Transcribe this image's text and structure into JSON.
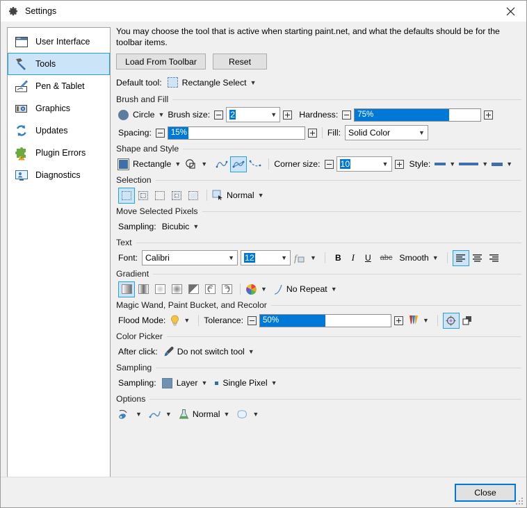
{
  "window": {
    "title": "Settings",
    "title_icon": "gear-icon",
    "close_icon": "close-x-icon"
  },
  "sidebar": {
    "items": [
      {
        "label": "User Interface",
        "icon": "window-icon",
        "selected": false
      },
      {
        "label": "Tools",
        "icon": "hammer-icon",
        "selected": true
      },
      {
        "label": "Pen & Tablet",
        "icon": "pen-tablet-icon",
        "selected": false
      },
      {
        "label": "Graphics",
        "icon": "graphics-card-icon",
        "selected": false
      },
      {
        "label": "Updates",
        "icon": "refresh-icon",
        "selected": false
      },
      {
        "label": "Plugin Errors",
        "icon": "puzzle-warning-icon",
        "selected": false
      },
      {
        "label": "Diagnostics",
        "icon": "monitor-person-icon",
        "selected": false
      }
    ]
  },
  "main": {
    "intro": "You may choose the tool that is active when starting paint.net, and what the defaults should be for the toolbar items.",
    "load_from_toolbar_button": "Load From Toolbar",
    "reset_button": "Reset",
    "default_tool_label": "Default tool:",
    "default_tool_value": "Rectangle Select",
    "groups": {
      "brush_and_fill": {
        "title": "Brush and Fill",
        "brush_shape": "Circle",
        "brush_size_label": "Brush size:",
        "brush_size_value": "2",
        "hardness_label": "Hardness:",
        "hardness_value": "75%",
        "hardness_pct": 75,
        "spacing_label": "Spacing:",
        "spacing_value": "15%",
        "spacing_pct": 15,
        "fill_label": "Fill:",
        "fill_value": "Solid Color"
      },
      "shape_and_style": {
        "title": "Shape and Style",
        "shape_value": "Rectangle",
        "corner_size_label": "Corner size:",
        "corner_size_value": "10",
        "style_label": "Style:",
        "curve_icons": [
          "open-curve-icon",
          "closed-curve-icon",
          "spline-curve-icon"
        ],
        "curve_selected_index": 1
      },
      "selection": {
        "title": "Selection",
        "modes": [
          "selection-replace-icon",
          "selection-union-icon",
          "selection-exclude-icon",
          "selection-xor-icon",
          "selection-intersect-icon"
        ],
        "selected_index": 0,
        "quality_value": "Normal"
      },
      "move_selected_pixels": {
        "title": "Move Selected Pixels",
        "sampling_label": "Sampling:",
        "sampling_value": "Bicubic"
      },
      "text": {
        "title": "Text",
        "font_label": "Font:",
        "font_value": "Calibri",
        "font_size_value": "12",
        "bold": "B",
        "italic": "I",
        "underline": "U",
        "strikethrough": "abc",
        "antialias_value": "Smooth",
        "align_icons": [
          "align-left-icon",
          "align-center-icon",
          "align-right-icon"
        ],
        "align_selected_index": 0
      },
      "gradient": {
        "title": "Gradient",
        "types": [
          "gradient-linear-icon",
          "gradient-linear-reflected-icon",
          "gradient-diamond-icon",
          "gradient-radial-icon",
          "gradient-conical-icon",
          "gradient-spiral-icon",
          "gradient-spiral-alt-icon"
        ],
        "selected_index": 0,
        "channel_icon": "color-wheel-icon",
        "repeat_value": "No Repeat"
      },
      "magic_wand": {
        "title": "Magic Wand, Paint Bucket, and Recolor",
        "flood_mode_label": "Flood Mode:",
        "flood_mode_icon": "lightbulb-icon",
        "tolerance_label": "Tolerance:",
        "tolerance_value": "50%",
        "tolerance_pct": 50,
        "blend_icon": "gradient-strip-icon",
        "sample_target_icon": "crosshair-target-icon",
        "overlap_icon": "overlap-squares-icon"
      },
      "color_picker": {
        "title": "Color Picker",
        "after_click_label": "After click:",
        "after_click_icon": "eyedropper-icon",
        "after_click_value": "Do not switch tool"
      },
      "sampling": {
        "title": "Sampling",
        "sampling_label": "Sampling:",
        "sampling_value": "Layer",
        "sample_size_value": "Single Pixel"
      },
      "options": {
        "title": "Options",
        "icons": [
          "brush-tail-icon",
          "squiggle-icon",
          "flask-icon",
          "cloud-shape-icon"
        ],
        "blend_value": "Normal"
      }
    }
  },
  "footer": {
    "close_button": "Close"
  },
  "colors": {
    "accent": "#0078d7",
    "selection_bg": "#cce4f7",
    "selection_border": "#26a0da",
    "window_bg": "#f0f0f0",
    "panel_bg": "#ffffff"
  }
}
